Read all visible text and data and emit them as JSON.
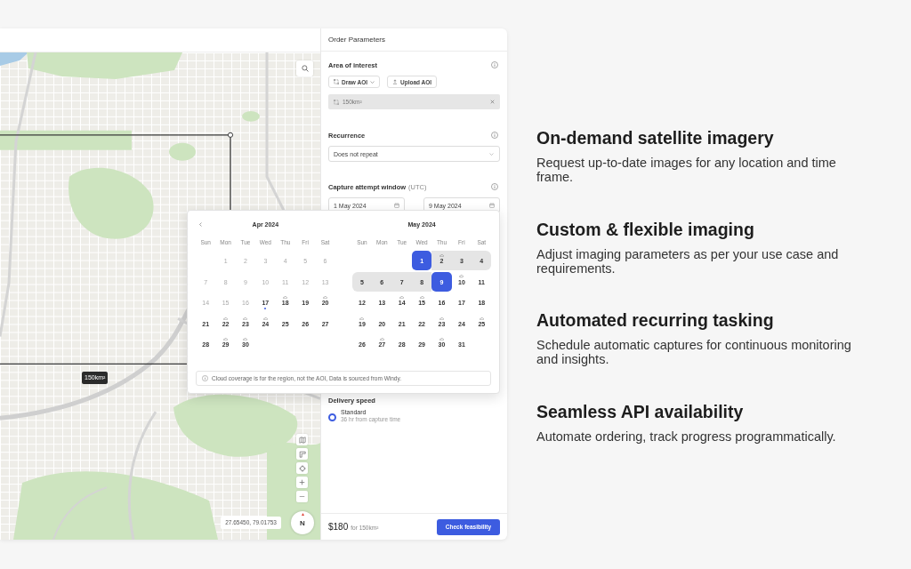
{
  "map": {
    "aoi_label": "150km²",
    "coordinates": "27.65450, 79.01753",
    "compass": "N"
  },
  "panel": {
    "title": "Order Parameters",
    "area_of_interest": {
      "label": "Area of interest",
      "buttons": [
        {
          "label": "Draw AOI",
          "kind": "draw"
        },
        {
          "label": "Upload AOI",
          "kind": "upload"
        }
      ],
      "selection": "150km²"
    },
    "recurrence": {
      "label": "Recurrence",
      "value": "Does not repeat"
    },
    "capture_window": {
      "label": "Capture attempt window",
      "timezone": "(UTC)",
      "start": "1 May 2024",
      "end": "9 May 2024"
    },
    "delivery_speed": {
      "label": "Delivery speed",
      "options": [
        {
          "label": "Standard",
          "detail": "36 hr from capture time",
          "selected": true
        }
      ]
    },
    "footer": {
      "price": "$180",
      "price_note": "for 150km²",
      "action": "Check feasibility"
    }
  },
  "calendar": {
    "months": [
      {
        "title": "Apr 2024",
        "weekdays": [
          "Sun",
          "Mon",
          "Tue",
          "Wed",
          "Thu",
          "Fri",
          "Sat"
        ],
        "weeks": [
          [
            {
              "day": "1",
              "disabled": true,
              "today": false,
              "cloudy": false,
              "selected": false,
              "in_range": false
            },
            {
              "day": "2",
              "disabled": true,
              "today": false,
              "cloudy": false,
              "selected": false,
              "in_range": false
            },
            {
              "day": "3",
              "disabled": true,
              "today": false,
              "cloudy": false,
              "selected": false,
              "in_range": false
            },
            {
              "day": "4",
              "disabled": true,
              "today": false,
              "cloudy": false,
              "selected": false,
              "in_range": false
            },
            {
              "day": "5",
              "disabled": true,
              "today": false,
              "cloudy": false,
              "selected": false,
              "in_range": false
            },
            {
              "day": "6",
              "disabled": true,
              "today": false,
              "cloudy": false,
              "selected": false,
              "in_range": false
            }
          ],
          [
            {
              "day": "7",
              "disabled": true,
              "today": false,
              "cloudy": false,
              "selected": false,
              "in_range": false
            },
            {
              "day": "8",
              "disabled": true,
              "today": false,
              "cloudy": false,
              "selected": false,
              "in_range": false
            },
            {
              "day": "9",
              "disabled": true,
              "today": false,
              "cloudy": false,
              "selected": false,
              "in_range": false
            },
            {
              "day": "10",
              "disabled": true,
              "today": false,
              "cloudy": false,
              "selected": false,
              "in_range": false
            },
            {
              "day": "11",
              "disabled": true,
              "today": false,
              "cloudy": false,
              "selected": false,
              "in_range": false
            },
            {
              "day": "12",
              "disabled": true,
              "today": false,
              "cloudy": false,
              "selected": false,
              "in_range": false
            },
            {
              "day": "13",
              "disabled": true,
              "today": false,
              "cloudy": false,
              "selected": false,
              "in_range": false
            }
          ],
          [
            {
              "day": "14",
              "disabled": true,
              "today": false,
              "cloudy": false,
              "selected": false,
              "in_range": false
            },
            {
              "day": "15",
              "disabled": true,
              "today": false,
              "cloudy": false,
              "selected": false,
              "in_range": false
            },
            {
              "day": "16",
              "disabled": true,
              "today": false,
              "cloudy": false,
              "selected": false,
              "in_range": false
            },
            {
              "day": "17",
              "disabled": false,
              "today": true,
              "cloudy": false,
              "selected": false,
              "in_range": false
            },
            {
              "day": "18",
              "disabled": false,
              "today": false,
              "cloudy": true,
              "selected": false,
              "in_range": false
            },
            {
              "day": "19",
              "disabled": false,
              "today": false,
              "cloudy": false,
              "selected": false,
              "in_range": false
            },
            {
              "day": "20",
              "disabled": false,
              "today": false,
              "cloudy": true,
              "selected": false,
              "in_range": false
            }
          ],
          [
            {
              "day": "21",
              "disabled": false,
              "today": false,
              "cloudy": false,
              "selected": false,
              "in_range": false
            },
            {
              "day": "22",
              "disabled": false,
              "today": false,
              "cloudy": true,
              "selected": false,
              "in_range": false
            },
            {
              "day": "23",
              "disabled": false,
              "today": false,
              "cloudy": true,
              "selected": false,
              "in_range": false
            },
            {
              "day": "24",
              "disabled": false,
              "today": false,
              "cloudy": true,
              "selected": false,
              "in_range": false
            },
            {
              "day": "25",
              "disabled": false,
              "today": false,
              "cloudy": false,
              "selected": false,
              "in_range": false
            },
            {
              "day": "26",
              "disabled": false,
              "today": false,
              "cloudy": false,
              "selected": false,
              "in_range": false
            },
            {
              "day": "27",
              "disabled": false,
              "today": false,
              "cloudy": false,
              "selected": false,
              "in_range": false
            }
          ],
          [
            {
              "day": "28",
              "disabled": false,
              "today": false,
              "cloudy": false,
              "selected": false,
              "in_range": false
            },
            {
              "day": "29",
              "disabled": false,
              "today": false,
              "cloudy": true,
              "selected": false,
              "in_range": false
            },
            {
              "day": "30",
              "disabled": false,
              "today": false,
              "cloudy": true,
              "selected": false,
              "in_range": false
            }
          ]
        ]
      },
      {
        "title": "May 2024",
        "weekdays": [
          "Sun",
          "Mon",
          "Tue",
          "Wed",
          "Thu",
          "Fri",
          "Sat"
        ],
        "weeks": [
          [
            {
              "day": "1",
              "disabled": false,
              "today": false,
              "cloudy": false,
              "selected": true,
              "in_range": true
            },
            {
              "day": "2",
              "disabled": false,
              "today": false,
              "cloudy": true,
              "selected": false,
              "in_range": true
            },
            {
              "day": "3",
              "disabled": false,
              "today": false,
              "cloudy": false,
              "selected": false,
              "in_range": true
            },
            {
              "day": "4",
              "disabled": false,
              "today": false,
              "cloudy": false,
              "selected": false,
              "in_range": true
            }
          ],
          [
            {
              "day": "5",
              "disabled": false,
              "today": false,
              "cloudy": false,
              "selected": false,
              "in_range": true
            },
            {
              "day": "6",
              "disabled": false,
              "today": false,
              "cloudy": false,
              "selected": false,
              "in_range": true
            },
            {
              "day": "7",
              "disabled": false,
              "today": false,
              "cloudy": false,
              "selected": false,
              "in_range": true
            },
            {
              "day": "8",
              "disabled": false,
              "today": false,
              "cloudy": false,
              "selected": false,
              "in_range": true
            },
            {
              "day": "9",
              "disabled": false,
              "today": false,
              "cloudy": false,
              "selected": true,
              "in_range": true
            },
            {
              "day": "10",
              "disabled": false,
              "today": false,
              "cloudy": true,
              "selected": false,
              "in_range": false
            },
            {
              "day": "11",
              "disabled": false,
              "today": false,
              "cloudy": false,
              "selected": false,
              "in_range": false
            }
          ],
          [
            {
              "day": "12",
              "disabled": false,
              "today": false,
              "cloudy": false,
              "selected": false,
              "in_range": false
            },
            {
              "day": "13",
              "disabled": false,
              "today": false,
              "cloudy": false,
              "selected": false,
              "in_range": false
            },
            {
              "day": "14",
              "disabled": false,
              "today": false,
              "cloudy": true,
              "selected": false,
              "in_range": false
            },
            {
              "day": "15",
              "disabled": false,
              "today": false,
              "cloudy": true,
              "selected": false,
              "in_range": false
            },
            {
              "day": "16",
              "disabled": false,
              "today": false,
              "cloudy": false,
              "selected": false,
              "in_range": false
            },
            {
              "day": "17",
              "disabled": false,
              "today": false,
              "cloudy": false,
              "selected": false,
              "in_range": false
            },
            {
              "day": "18",
              "disabled": false,
              "today": false,
              "cloudy": false,
              "selected": false,
              "in_range": false
            }
          ],
          [
            {
              "day": "19",
              "disabled": false,
              "today": false,
              "cloudy": true,
              "selected": false,
              "in_range": false
            },
            {
              "day": "20",
              "disabled": false,
              "today": false,
              "cloudy": false,
              "selected": false,
              "in_range": false
            },
            {
              "day": "21",
              "disabled": false,
              "today": false,
              "cloudy": false,
              "selected": false,
              "in_range": false
            },
            {
              "day": "22",
              "disabled": false,
              "today": false,
              "cloudy": false,
              "selected": false,
              "in_range": false
            },
            {
              "day": "23",
              "disabled": false,
              "today": false,
              "cloudy": true,
              "selected": false,
              "in_range": false
            },
            {
              "day": "24",
              "disabled": false,
              "today": false,
              "cloudy": false,
              "selected": false,
              "in_range": false
            },
            {
              "day": "25",
              "disabled": false,
              "today": false,
              "cloudy": true,
              "selected": false,
              "in_range": false
            }
          ],
          [
            {
              "day": "26",
              "disabled": false,
              "today": false,
              "cloudy": false,
              "selected": false,
              "in_range": false
            },
            {
              "day": "27",
              "disabled": false,
              "today": false,
              "cloudy": true,
              "selected": false,
              "in_range": false
            },
            {
              "day": "28",
              "disabled": false,
              "today": false,
              "cloudy": false,
              "selected": false,
              "in_range": false
            },
            {
              "day": "29",
              "disabled": false,
              "today": false,
              "cloudy": false,
              "selected": false,
              "in_range": false
            },
            {
              "day": "30",
              "disabled": false,
              "today": false,
              "cloudy": true,
              "selected": false,
              "in_range": false
            },
            {
              "day": "31",
              "disabled": false,
              "today": false,
              "cloudy": false,
              "selected": false,
              "in_range": false
            }
          ]
        ]
      }
    ],
    "note": "Cloud coverage is for the region, not the AOI, Data is sourced from Windy."
  },
  "features": [
    {
      "title": "On-demand satellite imagery",
      "text": "Request up-to-date images for any location and time frame."
    },
    {
      "title": "Custom & flexible imaging",
      "text": "Adjust imaging parameters as per your use case and requirements."
    },
    {
      "title": "Automated recurring tasking",
      "text": "Schedule automatic captures for continuous monitoring and insights."
    },
    {
      "title": "Seamless API availability",
      "text": "Automate ordering, track progress programmatically."
    }
  ]
}
